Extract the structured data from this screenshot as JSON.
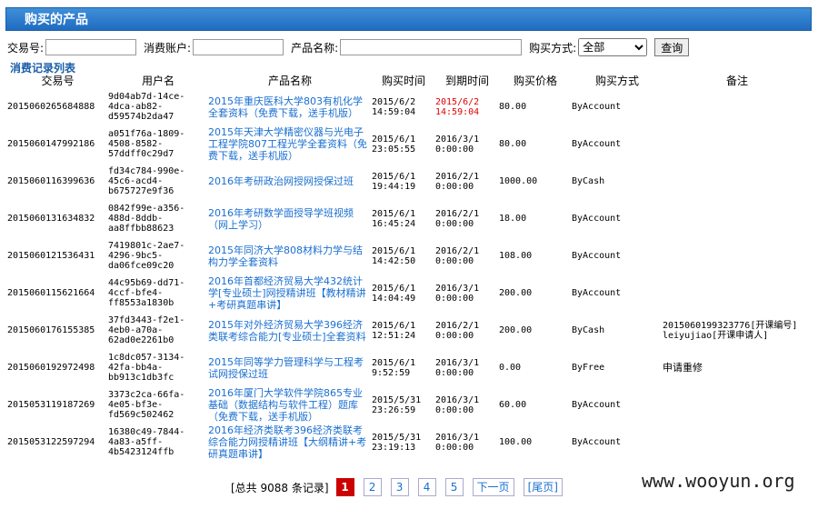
{
  "header": {
    "title": "购买的产品"
  },
  "search": {
    "trade_no_label": "交易号:",
    "account_label": "消费账户:",
    "product_label": "产品名称:",
    "method_label": "购买方式:",
    "method_selected": "全部",
    "query_label": "查询"
  },
  "section_title": "消费记录列表",
  "columns": [
    "交易号",
    "用户名",
    "产品名称",
    "购买时间",
    "到期时间",
    "购买价格",
    "购买方式",
    "备注"
  ],
  "rows": [
    {
      "trade": "2015060265684888",
      "user": "9d04ab7d-14ce-4dca-ab82-d59574b2da47",
      "product": "2015年重庆医科大学803有机化学全套资料（免费下载，送手机版）",
      "buy": "2015/6/2 14:59:04",
      "expire": "2015/6/2 14:59:04",
      "price": "80.00",
      "method": "ByAccount",
      "remark": ""
    },
    {
      "trade": "2015060147992186",
      "user": "a051f76a-1809-4508-8582-57ddff0c29d7",
      "product": "2015年天津大学精密仪器与光电子工程学院807工程光学全套资料（免费下载，送手机版）",
      "buy": "2015/6/1 23:05:55",
      "expire": "2016/3/1 0:00:00",
      "price": "80.00",
      "method": "ByAccount",
      "remark": ""
    },
    {
      "trade": "2015060116399636",
      "user": "fd34c784-990e-45c6-acd4-b675727e9f36",
      "product": "2016年考研政治网授网授保过班",
      "buy": "2015/6/1 19:44:19",
      "expire": "2016/2/1 0:00:00",
      "price": "1000.00",
      "method": "ByCash",
      "remark": ""
    },
    {
      "trade": "2015060131634832",
      "user": "0842f99e-a356-488d-8ddb-aa8ffbb88623",
      "product": "2016年考研数学面授导学班视频（网上学习）",
      "buy": "2015/6/1 16:45:24",
      "expire": "2016/2/1 0:00:00",
      "price": "18.00",
      "method": "ByAccount",
      "remark": ""
    },
    {
      "trade": "2015060121536431",
      "user": "7419801c-2ae7-4296-9bc5-da06fce09c20",
      "product": "2015年同济大学808材料力学与结构力学全套资料",
      "buy": "2015/6/1 14:42:50",
      "expire": "2016/2/1 0:00:00",
      "price": "108.00",
      "method": "ByAccount",
      "remark": ""
    },
    {
      "trade": "2015060115621664",
      "user": "44c95b69-dd71-4ccf-bfe4-ff8553a1830b",
      "product": "2016年首都经济贸易大学432统计学[专业硕士]网授精讲班【教材精讲+考研真题串讲】",
      "buy": "2015/6/1 14:04:49",
      "expire": "2016/3/1 0:00:00",
      "price": "200.00",
      "method": "ByAccount",
      "remark": ""
    },
    {
      "trade": "2015060176155385",
      "user": "37fd3443-f2e1-4eb0-a70a-62ad0e2261b0",
      "product": "2015年对外经济贸易大学396经济类联考综合能力[专业硕士]全套资料",
      "buy": "2015/6/1 12:51:24",
      "expire": "2016/2/1 0:00:00",
      "price": "200.00",
      "method": "ByCash",
      "remark": "2015060199323776[开课编号] leiyujiao[开课申请人]"
    },
    {
      "trade": "2015060192972498",
      "user": "1c8dc057-3134-42fa-bb4a-bb913c1db3fc",
      "product": "2015年同等学力管理科学与工程考试网授保过班",
      "buy": "2015/6/1 9:52:59",
      "expire": "2016/3/1 0:00:00",
      "price": "0.00",
      "method": "ByFree",
      "remark": "申请重修"
    },
    {
      "trade": "2015053119187269",
      "user": "3373c2ca-66fa-4e05-bf3e-fd569c502462",
      "product": "2016年厦门大学软件学院865专业基础（数据结构与软件工程）题库（免费下载，送手机版）",
      "buy": "2015/5/31 23:26:59",
      "expire": "2016/3/1 0:00:00",
      "price": "60.00",
      "method": "ByAccount",
      "remark": ""
    },
    {
      "trade": "2015053122597294",
      "user": "16380c49-7844-4a83-a5ff-4b5423124ffb",
      "product": "2016年经济类联考396经济类联考综合能力网授精讲班【大纲精讲+考研真题串讲】",
      "buy": "2015/5/31 23:19:13",
      "expire": "2016/3/1 0:00:00",
      "price": "100.00",
      "method": "ByAccount",
      "remark": ""
    }
  ],
  "pager": {
    "total": "[总共  9088 条记录]",
    "pages": [
      "1",
      "2",
      "3",
      "4",
      "5"
    ],
    "next": "下一页",
    "last": "[尾页]"
  },
  "watermark": "www.wooyun.org"
}
